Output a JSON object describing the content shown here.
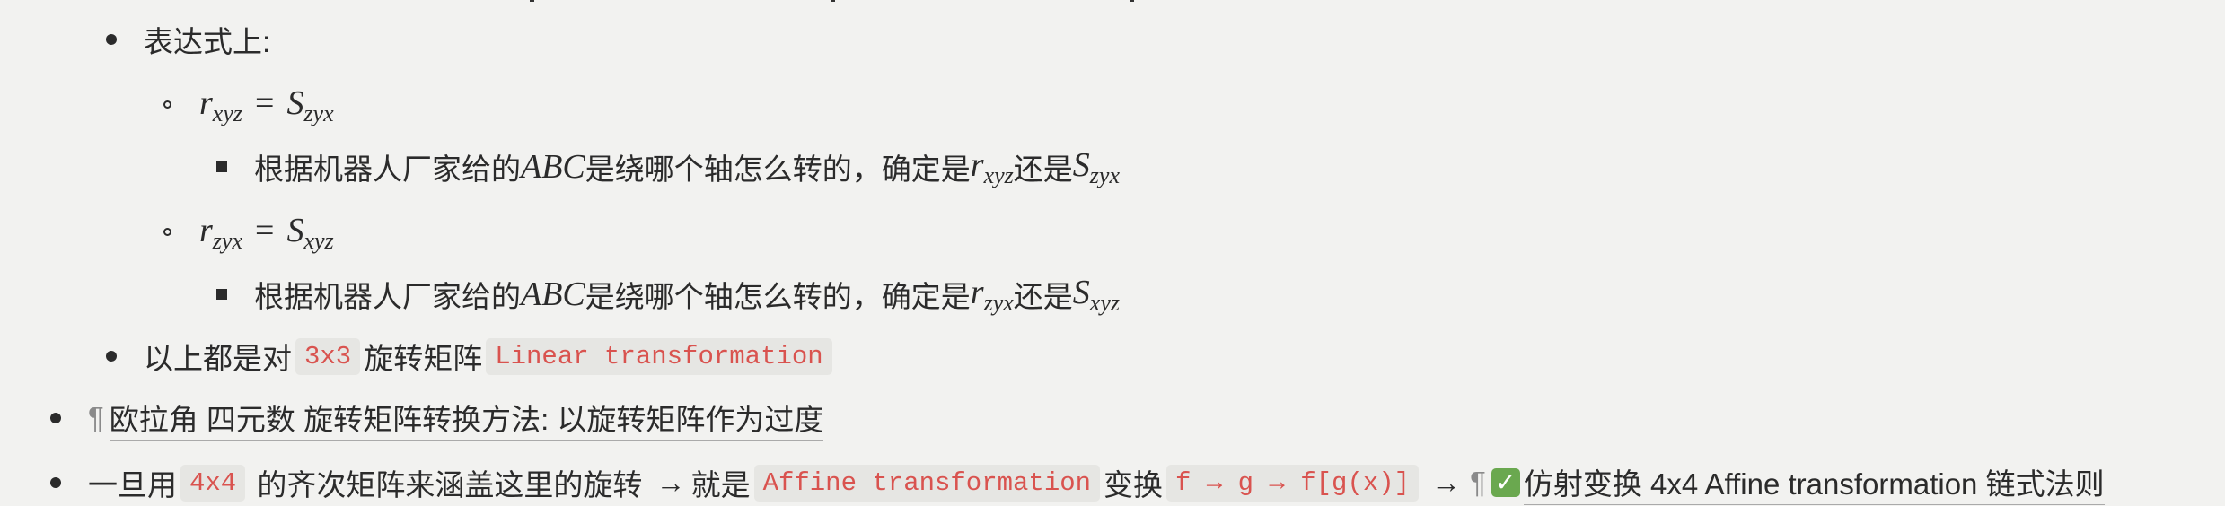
{
  "row1": {
    "label": "表达式上:"
  },
  "row2": {
    "lhs": "r",
    "lhs_sub": "xyz",
    "eq": "=",
    "rhs": "S",
    "rhs_sub": "zyx"
  },
  "row3": {
    "pre": "根据机器人厂家给的",
    "abc": "ABC",
    "mid": "是绕哪个轴怎么转的，确定是",
    "r": "r",
    "r_sub": "xyz",
    "or": "还是",
    "s": "S",
    "s_sub": "zyx"
  },
  "row4": {
    "lhs": "r",
    "lhs_sub": "zyx",
    "eq": "=",
    "rhs": "S",
    "rhs_sub": "xyz"
  },
  "row5": {
    "pre": "根据机器人厂家给的",
    "abc": "ABC",
    "mid": "是绕哪个轴怎么转的，确定是",
    "r": "r",
    "r_sub": "zyx",
    "or": "还是",
    "s": "S",
    "s_sub": "xyz"
  },
  "row6": {
    "pre": "以上都是对",
    "code1": "3x3",
    "mid": "旋转矩阵",
    "code2": "Linear transformation"
  },
  "row7": {
    "pilcrow": "¶",
    "link": "欧拉角 四元数 旋转矩阵转换方法: 以旋转矩阵作为过度"
  },
  "row8": {
    "pre": "一旦用",
    "code1": "4x4",
    "mid": " 的齐次矩阵来涵盖这里的旋转 ",
    "arrow1": "→",
    "jiushi": "就是",
    "code2": "Affine transformation",
    "bianhuan": "变换",
    "code3": "f → g → f[g(x)]",
    "arrow2": "→",
    "pilcrow": "¶",
    "check": "✓",
    "link": "仿射变换 4x4 Affine transformation 链式法则"
  }
}
